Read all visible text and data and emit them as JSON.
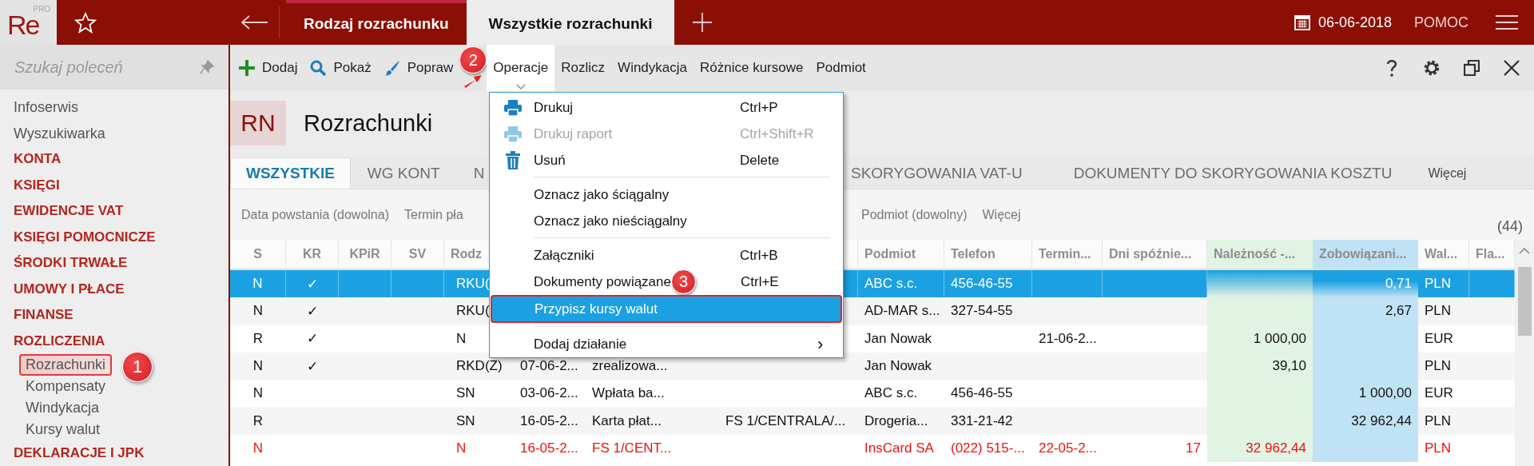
{
  "topbar": {
    "logo": {
      "text": "Re",
      "badge": "PRO"
    },
    "tabs": [
      {
        "label": "Rodzaj rozrachunku",
        "selected": false
      },
      {
        "label": "Wszystkie rozrachunki",
        "selected": true
      }
    ],
    "date": "06-06-2018",
    "help": "POMOC"
  },
  "sidebar": {
    "search": {
      "placeholder": "Szukaj poleceń"
    },
    "items": [
      {
        "label": "Infoserwis",
        "kind": "link",
        "selected": false
      },
      {
        "label": "Wyszukiwarka",
        "kind": "link",
        "selected": false
      },
      {
        "label": "KONTA",
        "kind": "section",
        "selected": false
      },
      {
        "label": "KSIĘGI",
        "kind": "section",
        "selected": false
      },
      {
        "label": "EWIDENCJE VAT",
        "kind": "section",
        "selected": false
      },
      {
        "label": "KSIĘGI POMOCNICZE",
        "kind": "section",
        "selected": false
      },
      {
        "label": "ŚRODKI TRWAŁE",
        "kind": "section",
        "selected": false
      },
      {
        "label": "UMOWY I PŁACE",
        "kind": "section",
        "selected": false
      },
      {
        "label": "FINANSE",
        "kind": "section",
        "selected": false
      },
      {
        "label": "ROZLICZENIA",
        "kind": "section",
        "selected": false,
        "children": [
          {
            "label": "Rozrachunki",
            "kind": "link",
            "selected": true
          },
          {
            "label": "Kompensaty",
            "kind": "link",
            "selected": false
          },
          {
            "label": "Windykacja",
            "kind": "link",
            "selected": false
          },
          {
            "label": "Kursy walut",
            "kind": "link",
            "selected": false
          }
        ]
      },
      {
        "label": "DEKLARACJE I JPK",
        "kind": "section",
        "selected": false
      }
    ]
  },
  "toolbar": {
    "buttons": [
      {
        "label": "Dodaj",
        "expanded": false
      },
      {
        "label": "Pokaż",
        "expanded": false
      },
      {
        "label": "Popraw",
        "expanded": false
      },
      {
        "label": "Operacje",
        "expanded": true
      },
      {
        "label": "Rozlicz",
        "expanded": false
      },
      {
        "label": "Windykacja",
        "expanded": false
      },
      {
        "label": "Różnice kursowe",
        "expanded": false
      },
      {
        "label": "Podmiot",
        "expanded": false
      }
    ]
  },
  "header": {
    "badge": "RN",
    "title": "Rozrachunki"
  },
  "tabs": [
    {
      "label": "WSZYSTKIE",
      "kind": "tab",
      "selected": true
    },
    {
      "label": "WG KONT",
      "kind": "tab",
      "selected": false
    },
    {
      "label": "N",
      "kind": "tab",
      "selected": false
    },
    {
      "label": "SKORYGOWANIA VAT-U",
      "kind": "tab",
      "selected": false
    },
    {
      "label": "DOKUMENTY DO SKORYGOWANIA KOSZTU",
      "kind": "tab",
      "selected": false
    },
    {
      "label": "Więcej",
      "kind": "more",
      "selected": false
    }
  ],
  "filters": {
    "items": [
      "Data powstania (dowolna)",
      "Termin pła",
      "Podmiot (dowolny)",
      "Więcej"
    ],
    "count": "(44)"
  },
  "table": {
    "columns": [
      "S",
      "KR",
      "KPiR",
      "SV",
      "Rodz",
      null,
      null,
      null,
      "Podmiot",
      "Telefon",
      "Termin...",
      "Dni spóźnie...",
      "Należność -...",
      "Zobowiązani...",
      "Wal...",
      "Fla..."
    ],
    "rows": [
      {
        "selected": true,
        "overdue": false,
        "cells": [
          "N",
          "✓",
          null,
          null,
          "RKU(",
          null,
          null,
          null,
          "ABC s.c.",
          "456-46-55",
          null,
          null,
          null,
          "0,71",
          "PLN",
          null
        ]
      },
      {
        "selected": false,
        "overdue": false,
        "cells": [
          "N",
          "✓",
          null,
          null,
          "RKU(",
          null,
          null,
          null,
          "AD-MAR s...",
          "327-54-55",
          null,
          null,
          null,
          "2,67",
          "PLN",
          null
        ]
      },
      {
        "selected": false,
        "overdue": false,
        "cells": [
          "R",
          "✓",
          null,
          null,
          "N",
          null,
          null,
          null,
          "Jan Nowak",
          null,
          "21-06-2...",
          null,
          "1 000,00",
          null,
          "EUR",
          null
        ]
      },
      {
        "selected": false,
        "overdue": false,
        "cells": [
          "N",
          "✓",
          null,
          null,
          "RKD(Z)",
          "07-06-2...",
          "zrealizowa...",
          null,
          "Jan Nowak",
          null,
          null,
          null,
          "39,10",
          null,
          "PLN",
          null
        ]
      },
      {
        "selected": false,
        "overdue": false,
        "cells": [
          "N",
          null,
          null,
          null,
          "SN",
          "03-06-2...",
          "Wpłata ba...",
          null,
          "ABC s.c.",
          "456-46-55",
          null,
          null,
          null,
          "1 000,00",
          "EUR",
          null
        ]
      },
      {
        "selected": false,
        "overdue": false,
        "cells": [
          "R",
          null,
          null,
          null,
          "SN",
          "16-05-2...",
          "Karta płat...",
          "FS 1/CENTRALA/...",
          "Drogeria...",
          "331-21-42",
          null,
          null,
          null,
          "32 962,44",
          "PLN",
          null
        ]
      },
      {
        "selected": false,
        "overdue": true,
        "cells": [
          "N",
          null,
          null,
          null,
          "N",
          "16-05-2...",
          "FS 1/CENT...",
          null,
          "InsCard SA",
          "(022) 515-...",
          "22-05-2...",
          "17",
          "32 962,44",
          null,
          "PLN",
          null
        ]
      }
    ]
  },
  "menu": {
    "items": [
      {
        "kind": "action",
        "label": "Drukuj",
        "shortcut": "Ctrl+P",
        "disabled": false,
        "selected": false
      },
      {
        "kind": "action",
        "label": "Drukuj raport",
        "shortcut": "Ctrl+Shift+R",
        "disabled": true,
        "selected": false
      },
      {
        "kind": "action",
        "label": "Usuń",
        "shortcut": "Delete",
        "disabled": false,
        "selected": false
      },
      {
        "kind": "separator"
      },
      {
        "kind": "action",
        "label": "Oznacz jako ściągalny",
        "disabled": false,
        "selected": false
      },
      {
        "kind": "action",
        "label": "Oznacz jako nieściągalny",
        "disabled": false,
        "selected": false
      },
      {
        "kind": "separator"
      },
      {
        "kind": "action",
        "label": "Załączniki",
        "shortcut": "Ctrl+B",
        "disabled": false,
        "selected": false
      },
      {
        "kind": "action",
        "label": "Dokumenty powiązane",
        "shortcut": "Ctrl+E",
        "disabled": false,
        "selected": false
      },
      {
        "kind": "action",
        "label": "Przypisz kursy walut",
        "disabled": false,
        "selected": true
      },
      {
        "kind": "separator"
      },
      {
        "kind": "submenu",
        "label": "Dodaj działanie",
        "arrow": "›",
        "disabled": false,
        "selected": false
      }
    ]
  },
  "annotations": [
    {
      "number": "1"
    },
    {
      "number": "2"
    },
    {
      "number": "3"
    }
  ]
}
